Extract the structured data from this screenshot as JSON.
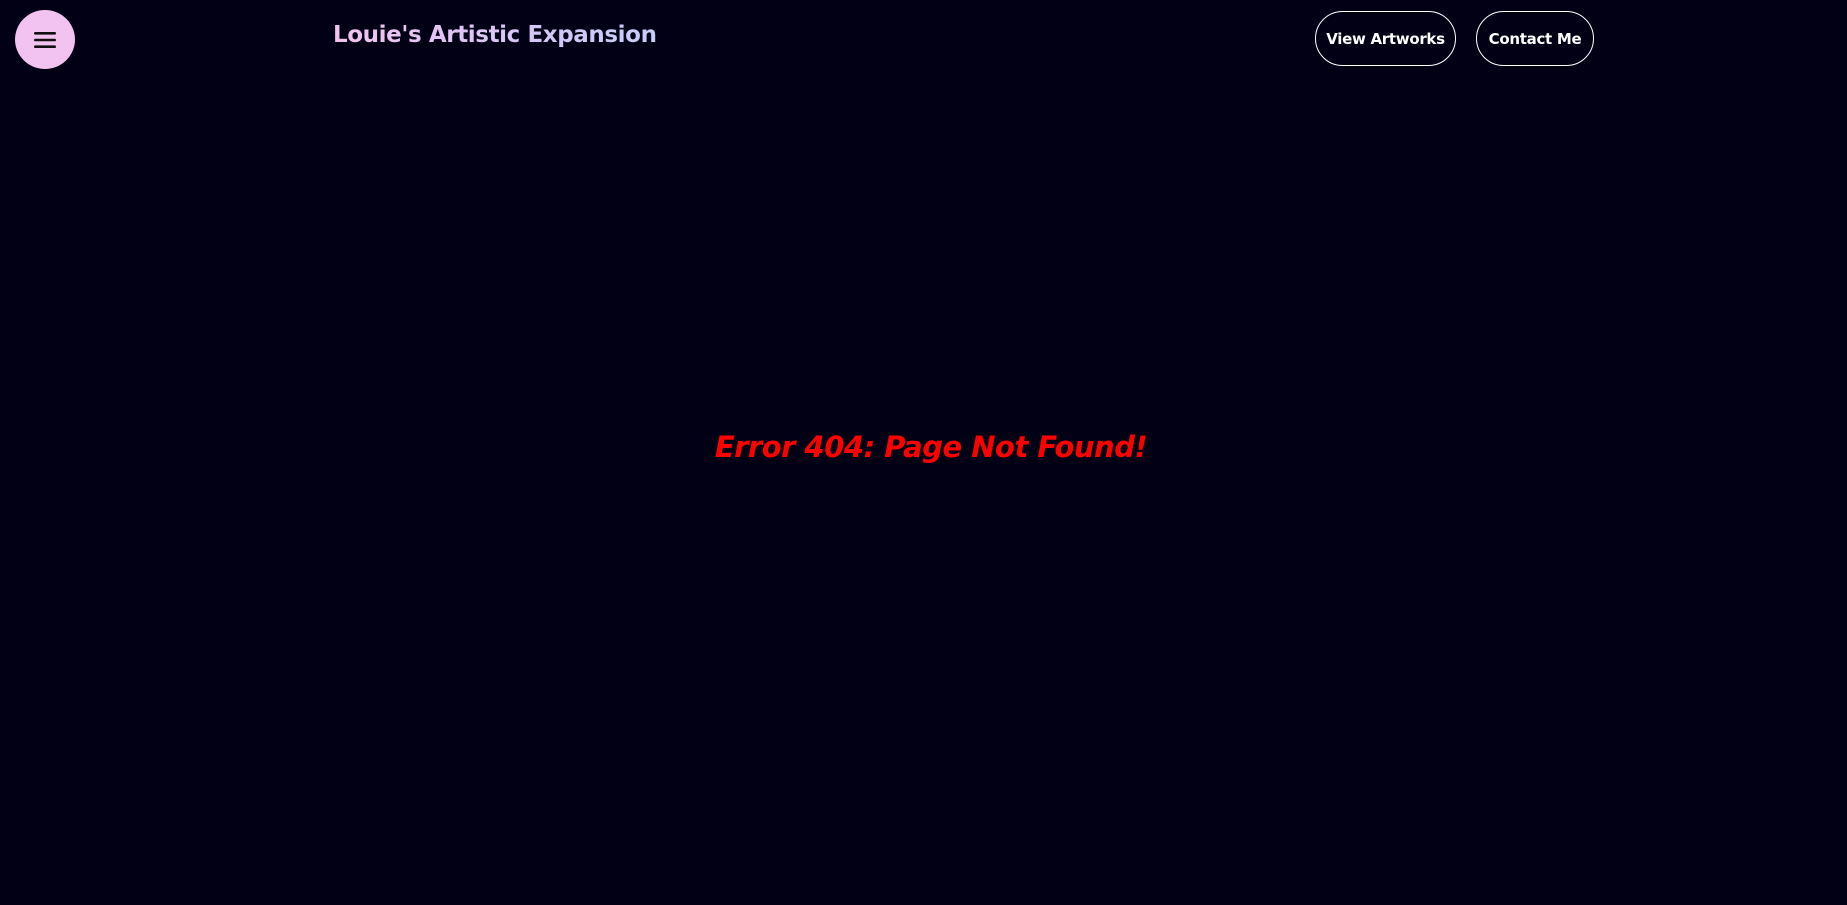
{
  "header": {
    "menu_icon": "hamburger-menu-icon",
    "title": "Louie's Artistic Expansion",
    "nav": {
      "view_artworks_label": "View Artworks",
      "contact_label": "Contact Me"
    }
  },
  "main": {
    "error_message": "Error 404: Page Not Found!"
  },
  "colors": {
    "background": "#020014",
    "menu_button": "#f2c2f0",
    "title_gradient_start": "#f2c2f0",
    "title_gradient_end": "#c4cdf7",
    "nav_border": "#ffffff",
    "error_text": "#ff0000"
  }
}
